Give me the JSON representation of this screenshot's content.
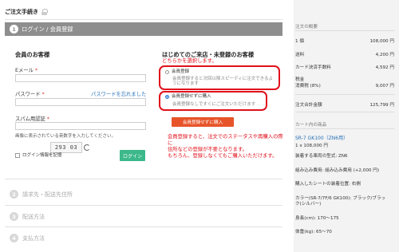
{
  "header": {
    "title": "ご注文手続き"
  },
  "steps": [
    {
      "num": "1",
      "label": "ログイン / 会員登録"
    },
    {
      "num": "2",
      "label": "請求先・配送先住所"
    },
    {
      "num": "3",
      "label": "配送方法"
    },
    {
      "num": "4",
      "label": "支払方法"
    }
  ],
  "login": {
    "heading": "会員のお客様",
    "email_label": "Eメール",
    "password_label": "パスワード",
    "forgot_link": "パスワードを忘れました",
    "captcha_label": "スパム用認証",
    "captcha_value": "293 03",
    "captcha_hint": "画像に表示されている英数字を入力してください。",
    "remember_label": "ログイン情報を記憶",
    "login_button": "ログイン",
    "required": "*"
  },
  "guest": {
    "heading": "はじめてのご来店・未登録のお客様",
    "choose_note": "どちらかを選択します。",
    "option_register_title": "会員登録",
    "option_register_desc": "会員登録すると次回以降スピーディに注文できるようになります",
    "option_guest_title": "会員登録せずに購入",
    "option_guest_desc": "会員登録なしですぐにご注文いただけます",
    "continue_button": "会員登録せずに購入",
    "annotation_lines": [
      "会員登録すると、注文でのステータスや再購入の際に",
      "住所などの登録が不要となります。",
      "もちろん、登録しなくてもご購入いただけます。"
    ]
  },
  "sidebar": {
    "summary_title": "注文の概要",
    "rows": [
      {
        "label": "1 個",
        "value": "108,000 円"
      },
      {
        "label": "送料",
        "value": "4,200 円"
      },
      {
        "label": "カード決済手数料",
        "value": "4,592 円"
      },
      {
        "label": "税金",
        "value": ""
      },
      {
        "label": "消費税 (8%)",
        "value": "9,007 円"
      },
      {
        "label": "注文合計金額",
        "value": "125,799 円"
      }
    ],
    "cart_title": "カート内の商品",
    "product_name": "SR-7 GK100（ZN6用）",
    "product_qty": "1 x 108,000 円",
    "details": [
      "装着する車両の型式: ZN6",
      "組み込み費用: 組み込み費用 (+2,000 円)",
      "購入したシートの装着位置: 右側",
      "カラー(SR-7/7F/6 GK100): ブラック/ブラック(シルバー)",
      "身長(cm): 170～175",
      "体重(kg): 65～70"
    ]
  }
}
